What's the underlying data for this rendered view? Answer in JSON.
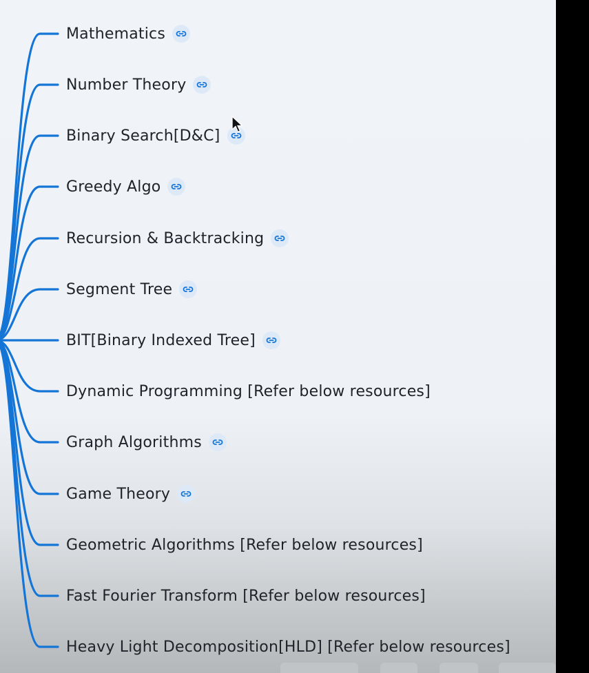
{
  "mindmap": {
    "branch_color": "#1475d6",
    "link_icon": "chain-link-icon",
    "nodes": [
      {
        "label": "Mathematics",
        "has_link": true
      },
      {
        "label": "Number Theory",
        "has_link": true
      },
      {
        "label": "Binary Search[D&C]",
        "has_link": true
      },
      {
        "label": "Greedy Algo",
        "has_link": true
      },
      {
        "label": "Recursion & Backtracking",
        "has_link": true
      },
      {
        "label": "Segment Tree",
        "has_link": true
      },
      {
        "label": "BIT[Binary Indexed Tree]",
        "has_link": true
      },
      {
        "label": "Dynamic Programming [Refer below resources]",
        "has_link": false
      },
      {
        "label": "Graph Algorithms",
        "has_link": true
      },
      {
        "label": "Game Theory",
        "has_link": true
      },
      {
        "label": "Geometric Algorithms [Refer below resources]",
        "has_link": false
      },
      {
        "label": "Fast Fourier Transform [Refer below resources]",
        "has_link": false
      },
      {
        "label": "Heavy Light Decomposition[HLD] [Refer below resources]",
        "has_link": false
      }
    ]
  }
}
